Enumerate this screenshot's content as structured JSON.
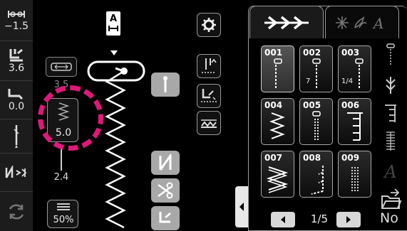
{
  "left_panel": {
    "twin_needle_width": "−1.5",
    "presser_pressure": "3.6",
    "thread_tension": "0.0",
    "buttons": [
      "twin-needle-width",
      "presser-foot-pressure",
      "thread-tension",
      "needle-position",
      "mirror-image",
      "reverse-restart"
    ]
  },
  "stitch_settings": {
    "width_label_faded": "3.5",
    "length_value": "5.0",
    "lower_value": "2.4",
    "speed_value": "50%"
  },
  "preview": {
    "foot_code": "A"
  },
  "tabs": {
    "active": "utility-stitches",
    "inactive": "decorative-characters"
  },
  "stitch_grid": [
    {
      "num": "001",
      "selected": true
    },
    {
      "num": "002",
      "sub": "7"
    },
    {
      "num": "003",
      "sub": "1/4"
    },
    {
      "num": "004"
    },
    {
      "num": "005"
    },
    {
      "num": "006"
    },
    {
      "num": "007"
    },
    {
      "num": "008"
    },
    {
      "num": "009"
    }
  ],
  "pager": {
    "text": "1/5"
  },
  "no_label": "No",
  "colors": {
    "highlight": "#e0187a",
    "panel_border": "#9a9a9a"
  }
}
